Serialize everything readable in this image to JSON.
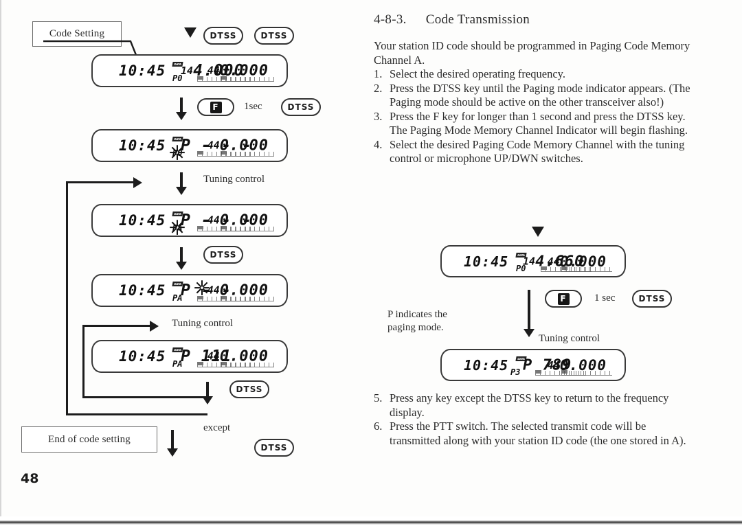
{
  "page": {
    "number": "48",
    "section_number": "4-8-3.",
    "section_title": "Code Transmission"
  },
  "right_column": {
    "intro": "Your station ID code should be programmed in Paging Code Memory Channel A.",
    "steps": [
      {
        "n": "1.",
        "text": "Select the desired operating frequency."
      },
      {
        "n": "2.",
        "text": "Press the DTSS key until the Paging mode indicator appears. (The Paging mode should be active on the other transceiver also!)"
      },
      {
        "n": "3.",
        "text": "Press the F key for longer than 1 second and press the DTSS key. The Paging Mode Memory Channel Indicator  will begin flashing."
      },
      {
        "n": "4.",
        "text": "Select  the desired Paging Code Memory Channel with the tuning control or microphone UP/DWN switches."
      },
      {
        "n": "5.",
        "text": "Press any key except the DTSS key to return to the frequency display."
      },
      {
        "n": "6.",
        "text": "Press the PTT switch. The selected transmit code will be transmitted along with your station ID code (the one stored in A)."
      }
    ],
    "diagram": {
      "note_line1": "P indicates the",
      "note_line2": "paging mode.",
      "label_1sec": "1 sec",
      "label_tuning": "Tuning  control",
      "key_f": "F",
      "key_dtss": "DTSS",
      "displays": [
        {
          "clock": "10:45",
          "data_badge": "DATA",
          "main_prefix": "14",
          "main_value": "4.660",
          "mem": "P0",
          "sub_prefix": "44",
          "sub_value": "0.000"
        },
        {
          "clock": "10:45",
          "data_badge": "DATA",
          "main_prefix": "",
          "main_value": "P 789",
          "mem": "P3",
          "sub_prefix": "44",
          "sub_value": "0.000"
        }
      ]
    }
  },
  "left_column": {
    "start_box": "Code Setting",
    "end_box": "End of code setting",
    "label_1sec": "1sec",
    "label_tuning": "Tuning control",
    "label_except": "except",
    "key_f": "F",
    "key_dtss": "DTSS",
    "displays": [
      {
        "clock": "10:45",
        "data_badge": "DATA",
        "main_prefix": "14",
        "main_value": "4.000",
        "mem": "P0",
        "mem_flashing": false,
        "sub_prefix": "44",
        "sub_value": "0.000",
        "code_flashing": false
      },
      {
        "clock": "10:45",
        "data_badge": "DATA",
        "main_prefix": "",
        "main_value": "P - - -",
        "mem": "P0",
        "mem_flashing": true,
        "sub_prefix": "44",
        "sub_value": "0.000",
        "code_flashing": false
      },
      {
        "clock": "10:45",
        "data_badge": "DATA",
        "main_prefix": "",
        "main_value": "P - - -",
        "mem": "PA",
        "mem_flashing": true,
        "sub_prefix": "44",
        "sub_value": "0.000",
        "code_flashing": false
      },
      {
        "clock": "10:45",
        "data_badge": "DATA",
        "main_prefix": "",
        "main_value": "P  - -",
        "mem": "PA",
        "mem_flashing": false,
        "sub_prefix": "44",
        "sub_value": "0.000",
        "code_flashing": true
      },
      {
        "clock": "10:45",
        "data_badge": "DATA",
        "main_prefix": "",
        "main_value": "P 111",
        "mem": "PA",
        "mem_flashing": false,
        "sub_prefix": "44",
        "sub_value": "0.000",
        "code_flashing": false
      }
    ]
  },
  "colors": {
    "ink": "#1c1c1c",
    "text": "#2b2b2b",
    "paper": "#fdfdfc"
  }
}
